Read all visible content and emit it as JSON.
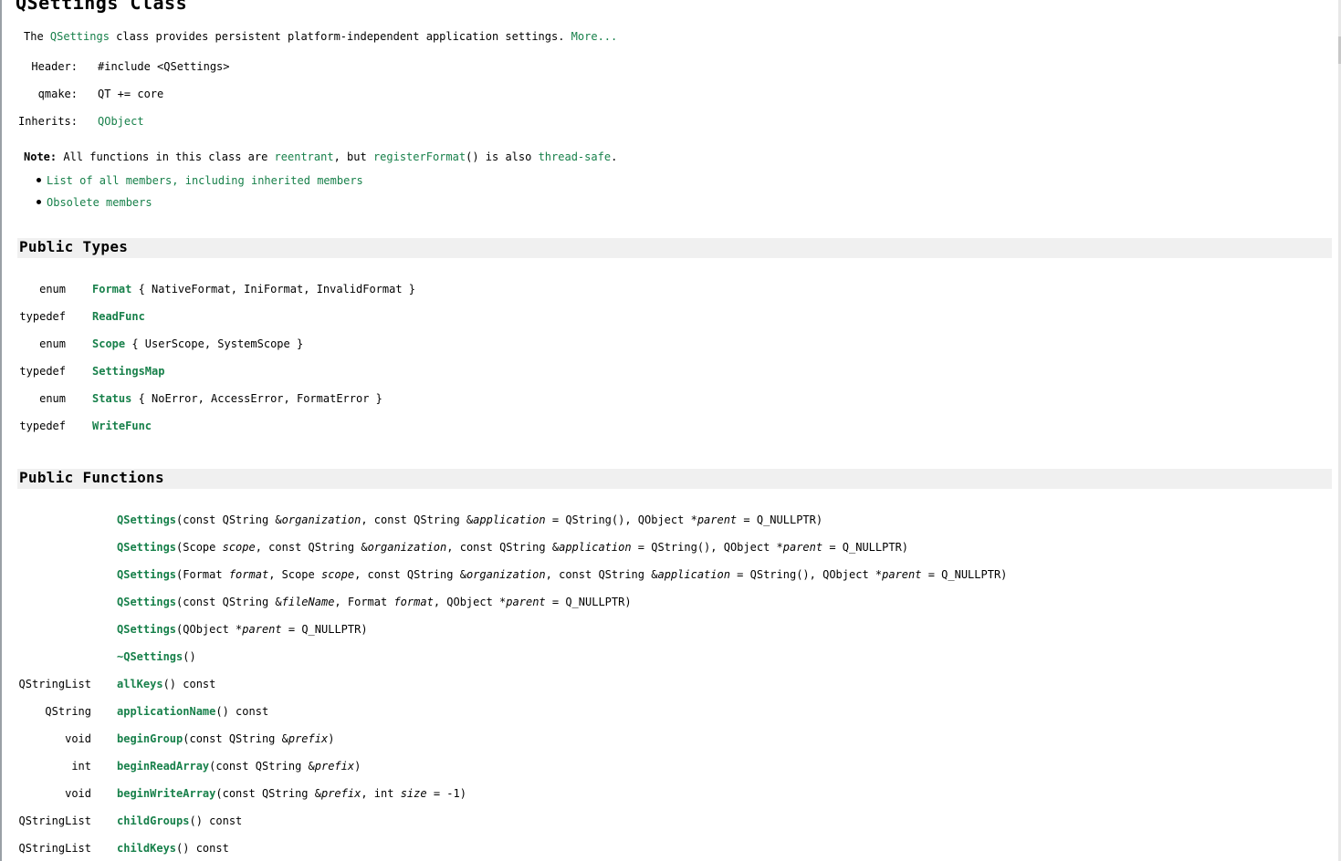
{
  "title": "QSettings Class",
  "brief": {
    "pre": "The ",
    "link": "QSettings",
    "text": " class provides persistent platform-independent application settings. ",
    "more": "More..."
  },
  "info": [
    {
      "key": "Header:",
      "value": "#include <QSettings>",
      "link": false
    },
    {
      "key": "qmake:",
      "value": "QT += core",
      "link": false
    },
    {
      "key": "Inherits:",
      "value": "QObject",
      "link": true
    }
  ],
  "note": {
    "label": "Note:",
    "t1": " All functions in this class are ",
    "l1": "reentrant",
    "t2": ", but ",
    "l2": "registerFormat",
    "t3": "() is also ",
    "l3": "thread-safe",
    "t4": "."
  },
  "links": [
    "List of all members, including inherited members",
    "Obsolete members"
  ],
  "public_types": {
    "heading": "Public Types",
    "rows": [
      {
        "kind": "enum",
        "name": "Format",
        "rest": " { NativeFormat, IniFormat, InvalidFormat }"
      },
      {
        "kind": "typedef",
        "name": "ReadFunc",
        "rest": ""
      },
      {
        "kind": "enum",
        "name": "Scope",
        "rest": " { UserScope, SystemScope }"
      },
      {
        "kind": "typedef",
        "name": "SettingsMap",
        "rest": ""
      },
      {
        "kind": "enum",
        "name": "Status",
        "rest": " { NoError, AccessError, FormatError }"
      },
      {
        "kind": "typedef",
        "name": "WriteFunc",
        "rest": ""
      }
    ]
  },
  "public_functions": {
    "heading": "Public Functions",
    "rows": [
      {
        "ret": "",
        "name": "QSettings",
        "sig": [
          [
            "(const QString &",
            0
          ],
          [
            "organization",
            1
          ],
          [
            ", const QString &",
            0
          ],
          [
            "application",
            1
          ],
          [
            " = QString(), QObject *",
            0
          ],
          [
            "parent",
            1
          ],
          [
            " = Q_NULLPTR)",
            0
          ]
        ]
      },
      {
        "ret": "",
        "name": "QSettings",
        "sig": [
          [
            "(Scope ",
            0
          ],
          [
            "scope",
            1
          ],
          [
            ", const QString &",
            0
          ],
          [
            "organization",
            1
          ],
          [
            ", const QString &",
            0
          ],
          [
            "application",
            1
          ],
          [
            " = QString(), QObject *",
            0
          ],
          [
            "parent",
            1
          ],
          [
            " = Q_NULLPTR)",
            0
          ]
        ]
      },
      {
        "ret": "",
        "name": "QSettings",
        "sig": [
          [
            "(Format ",
            0
          ],
          [
            "format",
            1
          ],
          [
            ", Scope ",
            0
          ],
          [
            "scope",
            1
          ],
          [
            ", const QString &",
            0
          ],
          [
            "organization",
            1
          ],
          [
            ", const QString &",
            0
          ],
          [
            "application",
            1
          ],
          [
            " = QString(), QObject *",
            0
          ],
          [
            "parent",
            1
          ],
          [
            " = Q_NULLPTR)",
            0
          ]
        ]
      },
      {
        "ret": "",
        "name": "QSettings",
        "sig": [
          [
            "(const QString &",
            0
          ],
          [
            "fileName",
            1
          ],
          [
            ", Format ",
            0
          ],
          [
            "format",
            1
          ],
          [
            ", QObject *",
            0
          ],
          [
            "parent",
            1
          ],
          [
            " = Q_NULLPTR)",
            0
          ]
        ]
      },
      {
        "ret": "",
        "name": "QSettings",
        "sig": [
          [
            "(QObject *",
            0
          ],
          [
            "parent",
            1
          ],
          [
            " = Q_NULLPTR)",
            0
          ]
        ]
      },
      {
        "ret": "",
        "name": "~QSettings",
        "sig": [
          [
            "()",
            0
          ]
        ]
      },
      {
        "ret": "QStringList",
        "name": "allKeys",
        "sig": [
          [
            "() const",
            0
          ]
        ]
      },
      {
        "ret": "QString",
        "name": "applicationName",
        "sig": [
          [
            "() const",
            0
          ]
        ]
      },
      {
        "ret": "void",
        "name": "beginGroup",
        "sig": [
          [
            "(const QString &",
            0
          ],
          [
            "prefix",
            1
          ],
          [
            ")",
            0
          ]
        ]
      },
      {
        "ret": "int",
        "name": "beginReadArray",
        "sig": [
          [
            "(const QString &",
            0
          ],
          [
            "prefix",
            1
          ],
          [
            ")",
            0
          ]
        ]
      },
      {
        "ret": "void",
        "name": "beginWriteArray",
        "sig": [
          [
            "(const QString &",
            0
          ],
          [
            "prefix",
            1
          ],
          [
            ", int ",
            0
          ],
          [
            "size",
            1
          ],
          [
            " = -1)",
            0
          ]
        ]
      },
      {
        "ret": "QStringList",
        "name": "childGroups",
        "sig": [
          [
            "() const",
            0
          ]
        ]
      },
      {
        "ret": "QStringList",
        "name": "childKeys",
        "sig": [
          [
            "() const",
            0
          ]
        ]
      }
    ]
  }
}
